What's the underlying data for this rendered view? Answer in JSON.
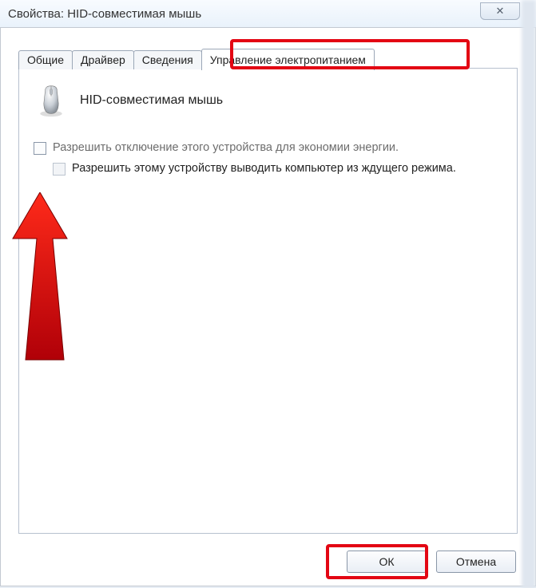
{
  "window": {
    "title": "Свойства: HID-совместимая мышь",
    "close_glyph": "✕"
  },
  "tabs": {
    "general": "Общие",
    "driver": "Драйвер",
    "details": "Сведения",
    "power": "Управление электропитанием"
  },
  "panel": {
    "device_name": "HID-совместимая мышь",
    "allow_off_label": "Разрешить отключение этого устройства для экономии энергии.",
    "allow_wake_label": "Разрешить этому устройству выводить компьютер из ждущего режима."
  },
  "buttons": {
    "ok": "ОК",
    "cancel": "Отмена"
  }
}
